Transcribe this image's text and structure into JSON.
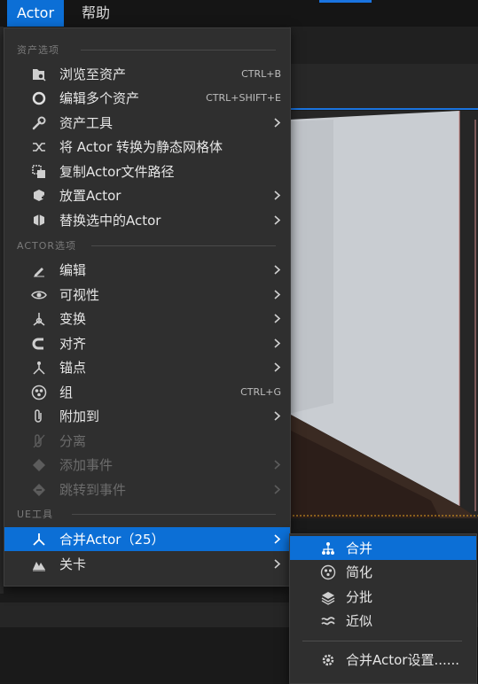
{
  "menubar": {
    "actor_label": "Actor",
    "help_label": "帮助"
  },
  "menu": {
    "sections": {
      "asset_options": "资产选项",
      "actor_options": "ACTOR选项",
      "ue_tools": "UE工具"
    },
    "items": [
      {
        "label": "浏览至资产",
        "shortcut": "CTRL+B",
        "icon": "browse-icon"
      },
      {
        "label": "编辑多个资产",
        "shortcut": "CTRL+SHIFT+E",
        "icon": "circle-icon"
      },
      {
        "label": "资产工具",
        "icon": "wrench-icon",
        "submenu": true
      },
      {
        "label": "将 Actor 转换为静态网格体",
        "icon": "convert-icon"
      },
      {
        "label": "复制Actor文件路径",
        "icon": "copy-path-icon"
      },
      {
        "label": "放置Actor",
        "icon": "place-actor-icon",
        "submenu": true
      },
      {
        "label": "替换选中的Actor",
        "icon": "replace-actor-icon",
        "submenu": true
      },
      {
        "label": "编辑",
        "icon": "pencil-icon",
        "submenu": true
      },
      {
        "label": "可视性",
        "icon": "eye-icon",
        "submenu": true
      },
      {
        "label": "变换",
        "icon": "transform-icon",
        "submenu": true
      },
      {
        "label": "对齐",
        "icon": "magnet-icon",
        "submenu": true
      },
      {
        "label": "锚点",
        "icon": "pivot-icon",
        "submenu": true
      },
      {
        "label": "组",
        "shortcut": "CTRL+G",
        "icon": "group-icon"
      },
      {
        "label": "附加到",
        "icon": "paperclip-icon",
        "submenu": true
      },
      {
        "label": "分离",
        "icon": "detach-icon",
        "disabled": true
      },
      {
        "label": "添加事件",
        "icon": "add-event-icon",
        "submenu": true,
        "disabled": true
      },
      {
        "label": "跳转到事件",
        "icon": "jump-event-icon",
        "submenu": true,
        "disabled": true
      },
      {
        "label": "合并Actor（25）",
        "icon": "merge-icon",
        "submenu": true,
        "highlighted": true
      },
      {
        "label": "关卡",
        "icon": "level-icon",
        "submenu": true
      }
    ]
  },
  "submenu": {
    "items": [
      {
        "label": "合并",
        "icon": "merge-tree-icon",
        "highlighted": true
      },
      {
        "label": "简化",
        "icon": "simplify-icon"
      },
      {
        "label": "分批",
        "icon": "batch-icon"
      },
      {
        "label": "近似",
        "icon": "approx-icon"
      },
      {
        "label": "合并Actor设置......",
        "icon": "gear-icon"
      }
    ]
  },
  "colors": {
    "accent": "#0c6fd6",
    "menu_bg": "#2f2f2f",
    "disabled_text": "#6c6c6c"
  }
}
